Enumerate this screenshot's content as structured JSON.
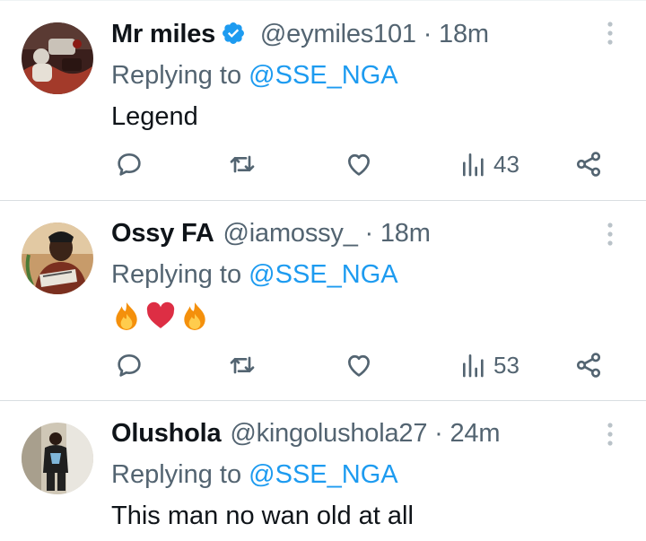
{
  "colors": {
    "text": "#0f1419",
    "muted": "#536471",
    "link": "#1d9bf0",
    "divider": "#d9dee1",
    "verified": "#1d9bf0"
  },
  "icons": {
    "verified": "verified-badge-icon",
    "more": "more-vertical-icon",
    "reply": "reply-icon",
    "retweet": "retweet-icon",
    "like": "heart-icon",
    "views": "views-icon",
    "share": "share-icon"
  },
  "tweets": [
    {
      "name": "Mr miles",
      "verified": true,
      "handle": "@eymiles101",
      "dot": "·",
      "time": "18m",
      "replying_prefix": "Replying to",
      "replying_to": "@SSE_NGA",
      "text": "Legend",
      "views": "43"
    },
    {
      "name": "Ossy FA",
      "verified": false,
      "handle": "@iamossy_",
      "dot": "·",
      "time": "18m",
      "replying_prefix": "Replying to",
      "replying_to": "@SSE_NGA",
      "emojis": [
        "fire",
        "red-heart",
        "fire"
      ],
      "views": "53"
    },
    {
      "name": "Olushola",
      "verified": false,
      "handle": "@kingolushola27",
      "dot": "·",
      "time": "24m",
      "replying_prefix": "Replying to",
      "replying_to": "@SSE_NGA",
      "text": "This man no wan old at all"
    }
  ]
}
